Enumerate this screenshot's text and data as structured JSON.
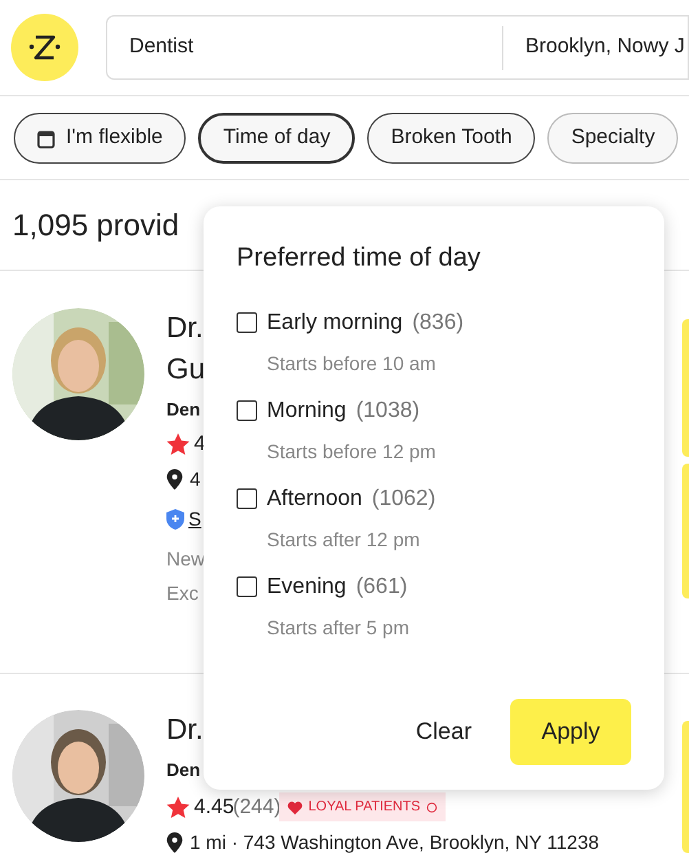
{
  "search": {
    "query": "Dentist",
    "location": "Brooklyn, Nowy J"
  },
  "chips": [
    {
      "label": "I'm flexible",
      "kind": "calendar",
      "selected": false
    },
    {
      "label": "Time of day",
      "kind": "plain",
      "selected": true
    },
    {
      "label": "Broken Tooth",
      "kind": "plain",
      "selected": false
    },
    {
      "label": "Specialty",
      "kind": "plain",
      "selected": false
    }
  ],
  "results_count": "1,095 provid",
  "providers": [
    {
      "name_lines": [
        "Dr.",
        "Gu"
      ],
      "specialty": "Den",
      "rating": "4",
      "distance": "4",
      "link": "S",
      "notes": [
        "New",
        "Exc"
      ]
    },
    {
      "name_lines": [
        "Dr."
      ],
      "specialty": "Den",
      "rating": "4.45",
      "reviews": "(244)",
      "badge": "LOYAL PATIENTS",
      "distance": "1 mi · 743 Washington Ave, Brooklyn, NY 11238"
    }
  ],
  "popover": {
    "title": "Preferred time of day",
    "options": [
      {
        "label": "Early morning",
        "count": "(836)",
        "hint": "Starts before 10 am",
        "checked": false
      },
      {
        "label": "Morning",
        "count": "(1038)",
        "hint": "Starts before 12 pm",
        "checked": false
      },
      {
        "label": "Afternoon",
        "count": "(1062)",
        "hint": "Starts after 12 pm",
        "checked": false
      },
      {
        "label": "Evening",
        "count": "(661)",
        "hint": "Starts after 5 pm",
        "checked": false
      }
    ],
    "buttons": [
      {
        "label": "Clear",
        "kind": "text"
      },
      {
        "label": "Apply",
        "kind": "primary"
      }
    ]
  }
}
